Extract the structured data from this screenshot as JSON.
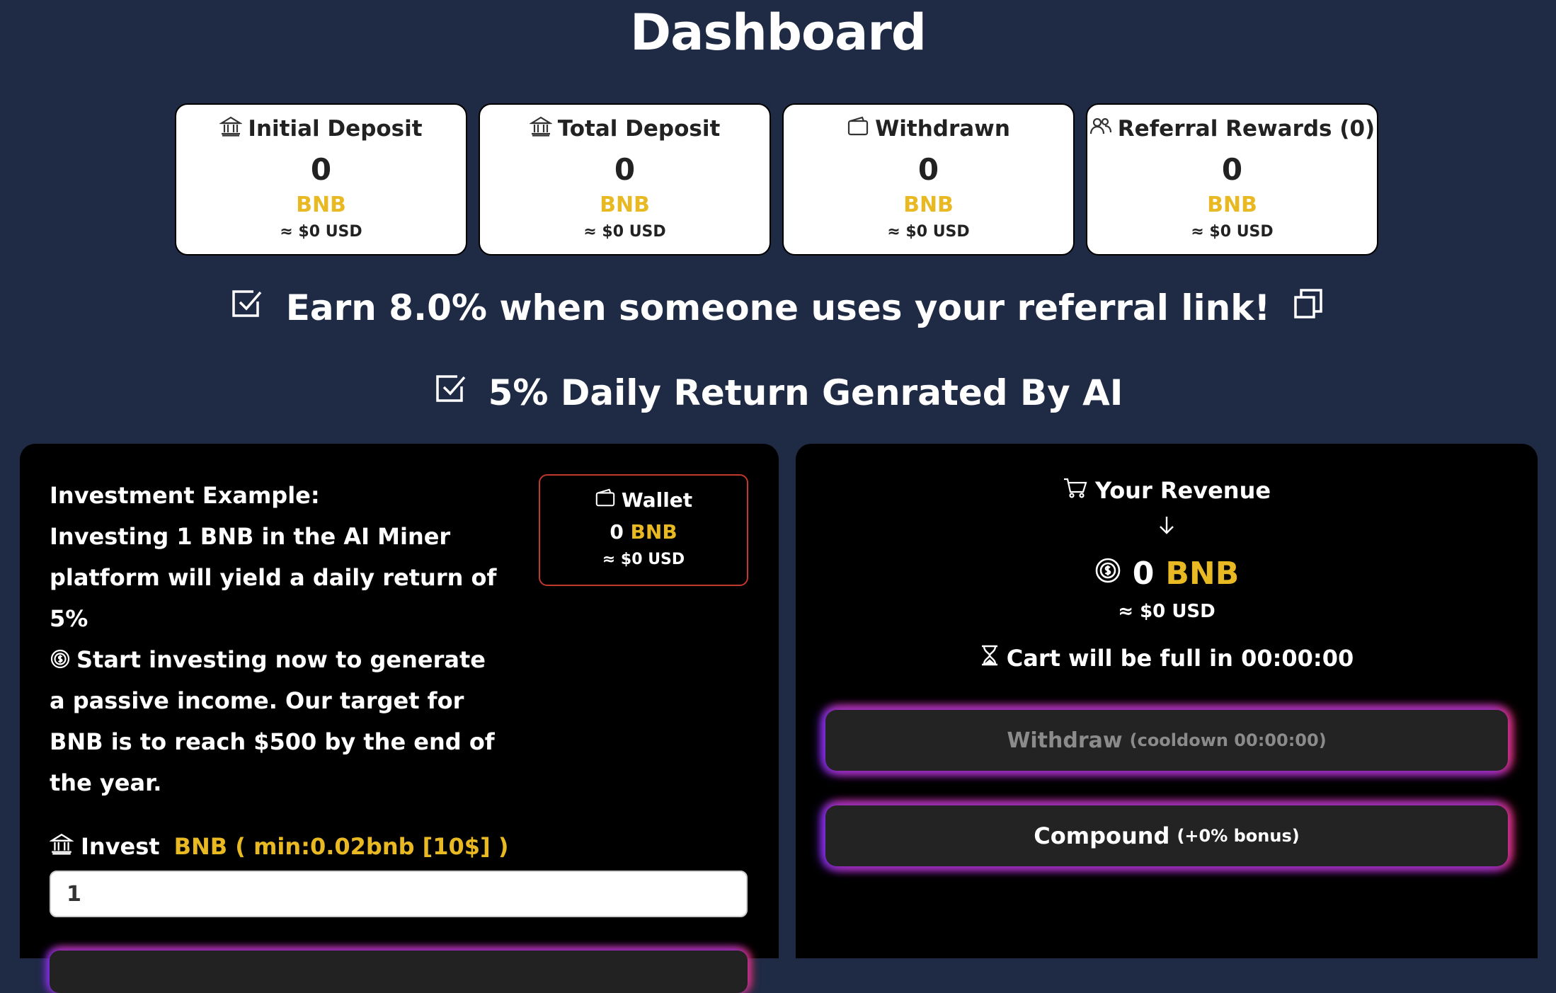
{
  "page": {
    "title": "Dashboard"
  },
  "stats": [
    {
      "label": "Initial Deposit",
      "icon": "bank-icon",
      "value": "0",
      "unit": "BNB",
      "usd": "≈ $0 USD"
    },
    {
      "label": "Total Deposit",
      "icon": "bank-icon",
      "value": "0",
      "unit": "BNB",
      "usd": "≈ $0 USD"
    },
    {
      "label": "Withdrawn",
      "icon": "wallet-icon",
      "value": "0",
      "unit": "BNB",
      "usd": "≈ $0 USD"
    },
    {
      "label": "Referral Rewards (0)",
      "icon": "users-icon",
      "value": "0",
      "unit": "BNB",
      "usd": "≈ $0 USD"
    }
  ],
  "referral": {
    "text": "Earn 8.0% when someone uses your referral link!"
  },
  "daily": {
    "text": "5% Daily Return Genrated By AI"
  },
  "example": {
    "heading": "Investment Example:",
    "line1": "Investing 1 BNB in the AI Miner platform will yield a daily return of 5%",
    "line2": "Start investing now to generate a passive income. Our target for BNB is to reach $500 by the end of the year."
  },
  "wallet": {
    "label": "Wallet",
    "balance": "0",
    "unit": "BNB",
    "usd": "≈ $0 USD"
  },
  "invest": {
    "label": "Invest",
    "hint": "BNB ( min:0.02bnb [10$] )",
    "value": "1"
  },
  "revenue": {
    "label": "Your Revenue",
    "amount": "0",
    "unit": "BNB",
    "usd": "≈ $0 USD",
    "cart_full": "Cart will be full in 00:00:00"
  },
  "actions": {
    "withdraw_label": "Withdraw",
    "withdraw_note": "(cooldown 00:00:00)",
    "compound_label": "Compound",
    "compound_note": "(+0% bonus)"
  },
  "colors": {
    "background": "#1f2a44",
    "accent": "#e8b923",
    "panel": "#000000",
    "glow_left": "#6a2cff",
    "glow_right": "#ff3358"
  }
}
